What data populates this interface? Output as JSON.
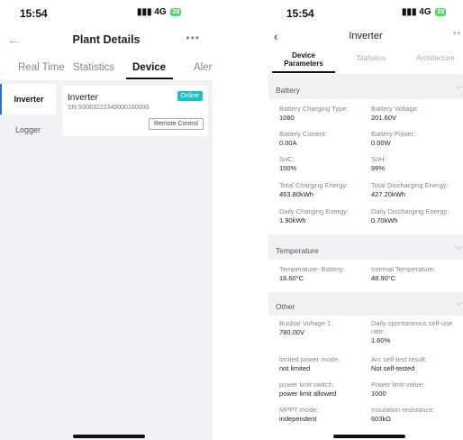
{
  "left": {
    "status": {
      "time": "15:54",
      "signal": "4G",
      "battery": "28"
    },
    "title": "Plant Details",
    "tabs": [
      "Real Time",
      "Statistics",
      "Device",
      "Alert"
    ],
    "side_items": [
      "Inverter",
      "Logger"
    ],
    "device": {
      "name": "Inverter",
      "sn": "SN:S006322234000016000​0",
      "status": "Online",
      "remote_label": "Remote Control"
    }
  },
  "right": {
    "status": {
      "time": "15:54",
      "signal": "4G",
      "battery": "28"
    },
    "title": "Inverter",
    "tabs": [
      "Device Parameters",
      "Statistics",
      "Architecture"
    ],
    "sections": [
      {
        "title": "Battery",
        "params": [
          {
            "label": "Battery Charging Type:",
            "value": "1080"
          },
          {
            "label": "Battery Voltage:",
            "value": "201.60V"
          },
          {
            "label": "Battery Current:",
            "value": "0.00A"
          },
          {
            "label": "Battery Power:",
            "value": "0.00W"
          },
          {
            "label": "SoC:",
            "value": "100%"
          },
          {
            "label": "SoH:",
            "value": "99%"
          },
          {
            "label": "Total Charging Energy:",
            "value": "463.80kWh"
          },
          {
            "label": "Total Discharging Energy:",
            "value": "427.20kWh"
          },
          {
            "label": "Daily Charging Energy:",
            "value": "1.90kWh"
          },
          {
            "label": "Daily Discharging Energy:",
            "value": "0.70kWh"
          }
        ]
      },
      {
        "title": "Temperature",
        "params": [
          {
            "label": "Temperature- Battery:",
            "value": "16.60°C"
          },
          {
            "label": "Internal Temperature:",
            "value": "48.90°C"
          }
        ]
      },
      {
        "title": "Other",
        "params": [
          {
            "label": "Busbar Voltage 1:",
            "value": "780.00V"
          },
          {
            "label": "Daily spontaneous self-use rate:",
            "value": "1.60%"
          },
          {
            "label": "limited power mode:",
            "value": "not limited"
          },
          {
            "label": "Arc self-test result:",
            "value": "Not self-tested"
          },
          {
            "label": "power limit switch:",
            "value": "power limit allowed"
          },
          {
            "label": "Power limit value:",
            "value": "1000"
          },
          {
            "label": "MPPT mode:",
            "value": "independent"
          },
          {
            "label": "Insulation resistance:",
            "value": "603kΩ"
          }
        ]
      }
    ]
  },
  "colors": {
    "accent": "#2b6fd6",
    "online": "#1cc0c8",
    "battery": "#4cd964"
  }
}
